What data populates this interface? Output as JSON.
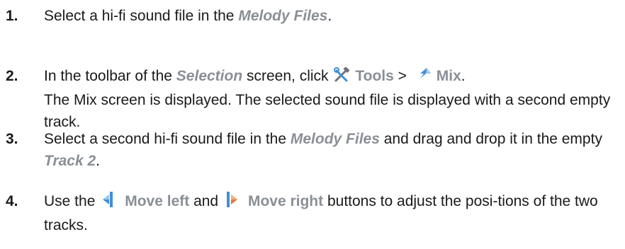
{
  "steps": [
    {
      "number": "1.",
      "t1": "Select a hi-fi sound file in the ",
      "ref1": "Melody Files",
      "t2": "."
    },
    {
      "number": "2.",
      "t1": "In the toolbar of the ",
      "ref1": "Selection",
      "t2": " screen, click ",
      "icon1": "tools-icon",
      "btn1": "Tools",
      "sep": " > ",
      "icon2": "mix-icon",
      "btn2": "Mix",
      "t3": ".",
      "line2": "The Mix screen is displayed. The selected sound file is displayed with a second empty track."
    },
    {
      "number": "3.",
      "t1": "Select a second hi-fi sound file in the ",
      "ref1": "Melody Files",
      "t2": " and drag and drop it in the empty ",
      "ref2": "Track 2",
      "t3": "."
    },
    {
      "number": "4.",
      "t1": "Use the ",
      "icon1": "move-left-icon",
      "btn1": "Move left",
      "t2": " and ",
      "icon2": "move-right-icon",
      "btn2": "Move right",
      "t3": " buttons to adjust the posi-tions of the two tracks."
    }
  ],
  "colors": {
    "text": "#1a1a1a",
    "reference": "#8a8f96",
    "icon_blue": "#3f8fd6"
  }
}
